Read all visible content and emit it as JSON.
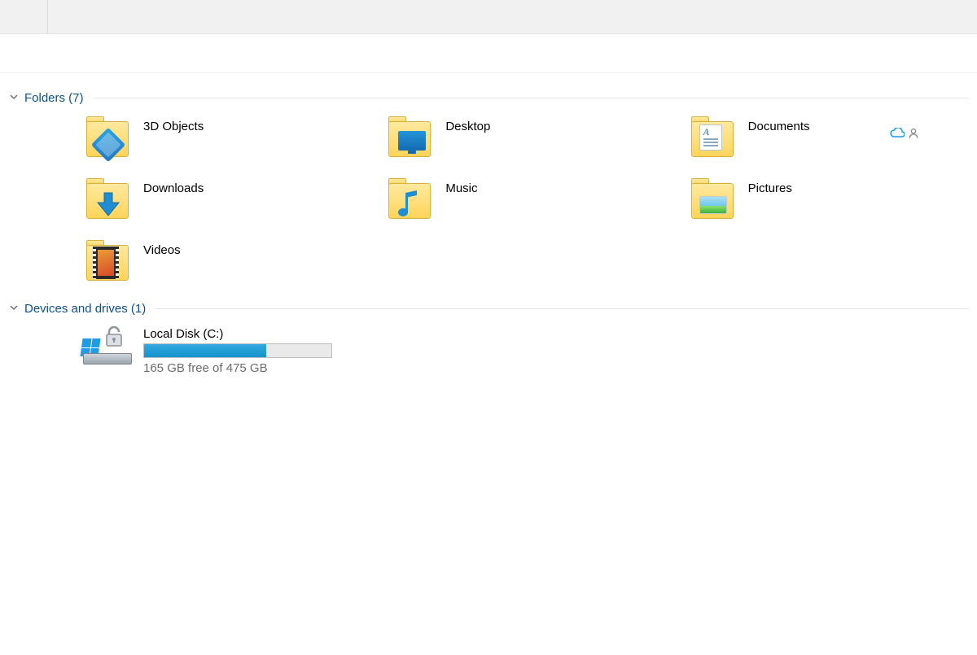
{
  "groups": {
    "folders": {
      "label": "Folders (7)"
    },
    "drives": {
      "label": "Devices and drives (1)"
    }
  },
  "folders": [
    {
      "name": "3D Objects"
    },
    {
      "name": "Desktop"
    },
    {
      "name": "Documents",
      "status": true
    },
    {
      "name": "Downloads"
    },
    {
      "name": "Music"
    },
    {
      "name": "Pictures"
    },
    {
      "name": "Videos"
    }
  ],
  "drives": [
    {
      "name": "Local Disk (C:)",
      "free_label": "165 GB free of 475 GB",
      "free_gb": 165,
      "total_gb": 475,
      "used_pct": 65
    }
  ]
}
